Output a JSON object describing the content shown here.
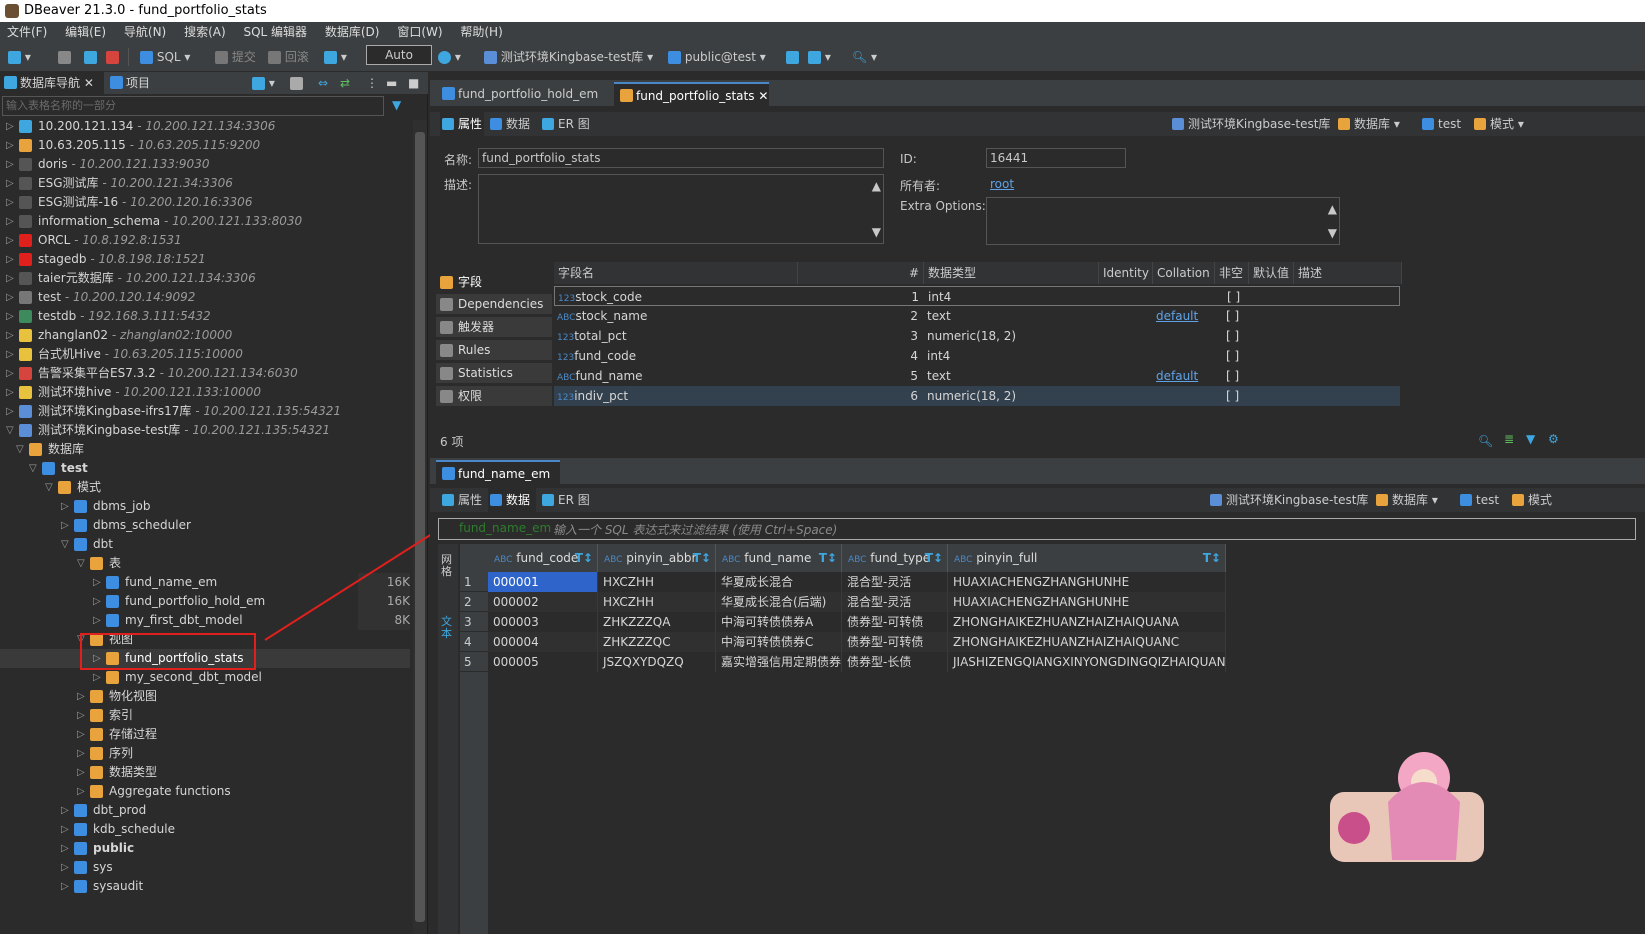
{
  "window": {
    "title": "DBeaver 21.3.0 - fund_portfolio_stats"
  },
  "menu": [
    "文件(F)",
    "编辑(E)",
    "导航(N)",
    "搜索(A)",
    "SQL 编辑器",
    "数据库(D)",
    "窗口(W)",
    "帮助(H)"
  ],
  "toolbar": {
    "sql": "SQL",
    "commit": "提交",
    "rollback": "回滚",
    "mode": "Auto",
    "connection": "测试环境Kingbase-test库",
    "schema": "public@test"
  },
  "left": {
    "tab_nav": "数据库导航",
    "tab_project": "项目",
    "filter_placeholder": "输入表格名称的一部分",
    "tree": [
      {
        "label": "10.200.121.134",
        "sub": "- 10.200.121.134:3306"
      },
      {
        "label": "10.63.205.115",
        "sub": "- 10.63.205.115:9200"
      },
      {
        "label": "doris",
        "sub": "- 10.200.121.133:9030"
      },
      {
        "label": "ESG测试库",
        "sub": "- 10.200.121.34:3306"
      },
      {
        "label": "ESG测试库-16",
        "sub": "- 10.200.120.16:3306"
      },
      {
        "label": "information_schema",
        "sub": "- 10.200.121.133:8030"
      },
      {
        "label": "ORCL",
        "sub": "- 10.8.192.8:1531"
      },
      {
        "label": "stagedb",
        "sub": "- 10.8.198.18:1521"
      },
      {
        "label": "taier元数据库",
        "sub": "- 10.200.121.134:3306"
      },
      {
        "label": "test",
        "sub": "- 10.200.120.14:9092"
      },
      {
        "label": "testdb",
        "sub": "- 192.168.3.111:5432"
      },
      {
        "label": "zhanglan02",
        "sub": "- zhanglan02:10000"
      },
      {
        "label": "台式机Hive",
        "sub": "- 10.63.205.115:10000"
      },
      {
        "label": "告警采集平台ES7.3.2",
        "sub": "- 10.200.121.134:6030"
      },
      {
        "label": "测试环境hive",
        "sub": "- 10.200.121.133:10000"
      },
      {
        "label": "测试环境Kingbase-ifrs17库",
        "sub": "- 10.200.121.135:54321"
      },
      {
        "label": "测试环境Kingbase-test库",
        "sub": "- 10.200.121.135:54321"
      },
      {
        "label": "数据库",
        "sub": ""
      },
      {
        "label": "test",
        "sub": ""
      },
      {
        "label": "模式",
        "sub": ""
      },
      {
        "label": "dbms_job",
        "sub": ""
      },
      {
        "label": "dbms_scheduler",
        "sub": ""
      },
      {
        "label": "dbt",
        "sub": ""
      },
      {
        "label": "表",
        "sub": ""
      },
      {
        "label": "fund_name_em",
        "sub": "",
        "size": "16K"
      },
      {
        "label": "fund_portfolio_hold_em",
        "sub": "",
        "size": "16K"
      },
      {
        "label": "my_first_dbt_model",
        "sub": "",
        "size": "8K"
      },
      {
        "label": "视图",
        "sub": ""
      },
      {
        "label": "fund_portfolio_stats",
        "sub": ""
      },
      {
        "label": "my_second_dbt_model",
        "sub": ""
      },
      {
        "label": "物化视图",
        "sub": ""
      },
      {
        "label": "索引",
        "sub": ""
      },
      {
        "label": "存储过程",
        "sub": ""
      },
      {
        "label": "序列",
        "sub": ""
      },
      {
        "label": "数据类型",
        "sub": ""
      },
      {
        "label": "Aggregate functions",
        "sub": ""
      },
      {
        "label": "dbt_prod",
        "sub": ""
      },
      {
        "label": "kdb_schedule",
        "sub": ""
      },
      {
        "label": "public",
        "sub": ""
      },
      {
        "label": "sys",
        "sub": ""
      },
      {
        "label": "sysaudit",
        "sub": ""
      }
    ]
  },
  "editor": {
    "tabs": [
      "fund_portfolio_hold_em",
      "fund_portfolio_stats"
    ],
    "subtabs": [
      "属性",
      "数据",
      "ER 图"
    ],
    "crumbs": [
      "测试环境Kingbase-test库",
      "数据库",
      "test",
      "模式"
    ],
    "props": {
      "name_label": "名称:",
      "name": "fund_portfolio_stats",
      "desc_label": "描述:",
      "id_label": "ID:",
      "id": "16441",
      "owner_label": "所有者:",
      "owner": "root",
      "extra_label": "Extra Options:"
    },
    "sidetabs": [
      "字段",
      "Dependencies",
      "触发器",
      "Rules",
      "Statistics",
      "权限"
    ],
    "columns_header": [
      "字段名",
      "#",
      "数据类型",
      "Identity",
      "Collation",
      "非空",
      "默认值",
      "描述"
    ],
    "columns": [
      {
        "name": "stock_code",
        "no": "1",
        "type": "int4",
        "kind": "123",
        "collation": "",
        "notnull": "[ ]"
      },
      {
        "name": "stock_name",
        "no": "2",
        "type": "text",
        "kind": "ABC",
        "collation": "default",
        "notnull": "[ ]"
      },
      {
        "name": "total_pct",
        "no": "3",
        "type": "numeric(18, 2)",
        "kind": "123",
        "collation": "",
        "notnull": "[ ]"
      },
      {
        "name": "fund_code",
        "no": "4",
        "type": "int4",
        "kind": "123",
        "collation": "",
        "notnull": "[ ]"
      },
      {
        "name": "fund_name",
        "no": "5",
        "type": "text",
        "kind": "ABC",
        "collation": "default",
        "notnull": "[ ]"
      },
      {
        "name": "indiv_pct",
        "no": "6",
        "type": "numeric(18, 2)",
        "kind": "123",
        "collation": "",
        "notnull": "[ ]"
      }
    ],
    "count": "6 项"
  },
  "lower": {
    "tab": "fund_name_em",
    "subtabs": [
      "属性",
      "数据",
      "ER 图"
    ],
    "crumbs": [
      "测试环境Kingbase-test库",
      "数据库",
      "test",
      "模式"
    ],
    "filter_table": "fund_name_em",
    "filter_placeholder": "输入一个 SQL 表达式来过滤结果 (使用 Ctrl+Space)",
    "vtab_grid": "网格",
    "vtab_text": "文本",
    "headers": [
      "fund_code",
      "pinyin_abbr",
      "fund_name",
      "fund_type",
      "pinyin_full"
    ],
    "rows": [
      {
        "no": "1",
        "fund_code": "000001",
        "pinyin_abbr": "HXCZHH",
        "fund_name": "华夏成长混合",
        "fund_type": "混合型-灵活",
        "pinyin_full": "HUAXIACHENGZHANGHUNHE"
      },
      {
        "no": "2",
        "fund_code": "000002",
        "pinyin_abbr": "HXCZHH",
        "fund_name": "华夏成长混合(后端)",
        "fund_type": "混合型-灵活",
        "pinyin_full": "HUAXIACHENGZHANGHUNHE"
      },
      {
        "no": "3",
        "fund_code": "000003",
        "pinyin_abbr": "ZHKZZZQA",
        "fund_name": "中海可转债债券A",
        "fund_type": "债券型-可转债",
        "pinyin_full": "ZHONGHAIKEZHUANZHAIZHAIQUANA"
      },
      {
        "no": "4",
        "fund_code": "000004",
        "pinyin_abbr": "ZHKZZZQC",
        "fund_name": "中海可转债债券C",
        "fund_type": "债券型-可转债",
        "pinyin_full": "ZHONGHAIKEZHUANZHAIZHAIQUANC"
      },
      {
        "no": "5",
        "fund_code": "000005",
        "pinyin_abbr": "JSZQXYDQZQ",
        "fund_name": "嘉实增强信用定期债券",
        "fund_type": "债券型-长债",
        "pinyin_full": "JIASHIZENGQIANGXINYONGDINGQIZHAIQUAN"
      }
    ]
  },
  "colors": {
    "accent": "#4a88c7",
    "annotation": "#e0201c",
    "folder": "#e8a33d",
    "table": "#3d8ee0"
  }
}
